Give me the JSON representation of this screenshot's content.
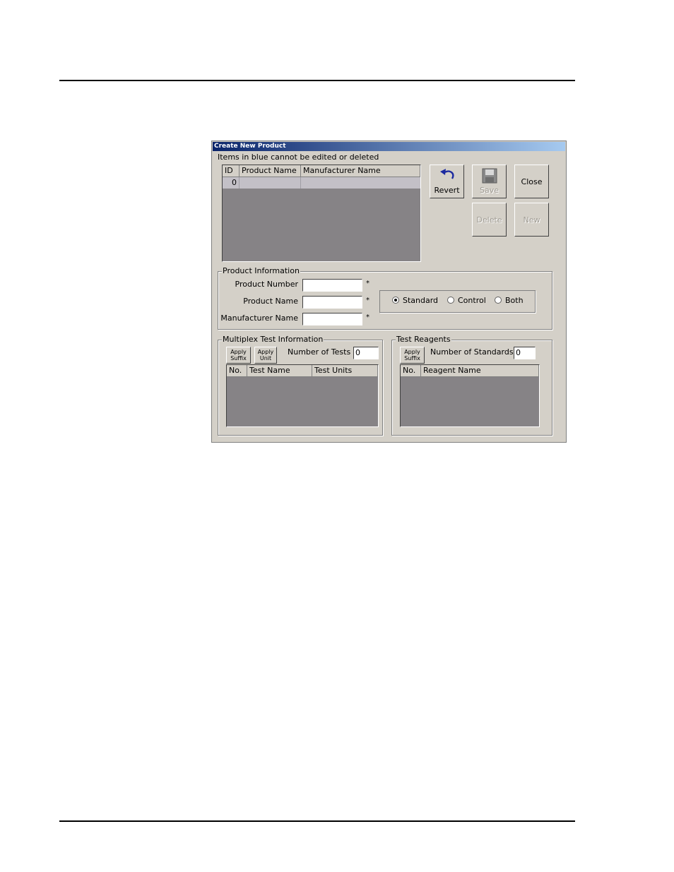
{
  "window": {
    "title": "Create New Product"
  },
  "notice": "Items in blue cannot be edited or deleted",
  "products_table": {
    "columns": [
      "ID",
      "Product Name",
      "Manufacturer Name"
    ],
    "rows": [
      {
        "id": "0",
        "product_name": "",
        "manufacturer_name": ""
      }
    ]
  },
  "toolbar": {
    "revert_label": "Revert",
    "save_label": "Save",
    "close_label": "Close",
    "delete_label": "Delete",
    "new_label": "New"
  },
  "product_info": {
    "legend": "Product Information",
    "product_number_label": "Product Number",
    "product_name_label": "Product Name",
    "manufacturer_name_label": "Manufacturer Name",
    "product_number_value": "",
    "product_name_value": "",
    "manufacturer_name_value": "",
    "required_marker": "*",
    "type_options": [
      "Standard",
      "Control",
      "Both"
    ],
    "type_selected": "Standard"
  },
  "multiplex": {
    "legend": "Multiplex Test Information",
    "apply_suffix_label": "Apply Suffix",
    "apply_unit_label": "Apply Unit",
    "number_of_tests_label": "Number of Tests",
    "number_of_tests_value": "0",
    "columns": [
      "No.",
      "Test Name",
      "Test Units"
    ]
  },
  "reagents": {
    "legend": "Test Reagents",
    "apply_suffix_label": "Apply Suffix",
    "number_of_standards_label": "Number of Standards",
    "number_of_standards_value": "0",
    "columns": [
      "No.",
      "Reagent Name"
    ]
  },
  "colors": {
    "title_start": "#0a246a",
    "title_end": "#a6caf0",
    "face": "#d4d0c8",
    "grid": "#868386"
  }
}
